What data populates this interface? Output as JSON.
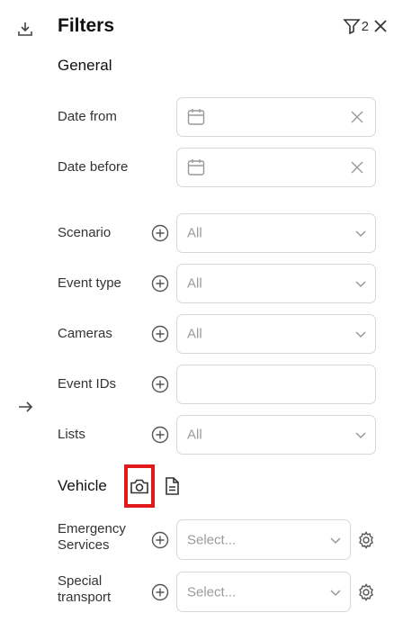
{
  "header": {
    "title": "Filters",
    "active_filter_count": "2"
  },
  "sections": {
    "general": "General",
    "vehicle": "Vehicle"
  },
  "date_fields": [
    {
      "label": "Date from",
      "value": ""
    },
    {
      "label": "Date before",
      "value": ""
    }
  ],
  "select_fields": [
    {
      "label": "Scenario",
      "value": "All"
    },
    {
      "label": "Event type",
      "value": "All"
    },
    {
      "label": "Cameras",
      "value": "All"
    },
    {
      "label": "Event IDs",
      "value": ""
    },
    {
      "label": "Lists",
      "value": "All"
    }
  ],
  "vehicle_fields": [
    {
      "label_line1": "Emergency",
      "label_line2": "Services",
      "placeholder": "Select..."
    },
    {
      "label_line1": "Special",
      "label_line2": "transport",
      "placeholder": "Select..."
    }
  ],
  "icons": {
    "download": "download-icon",
    "expand": "arrow-right-icon",
    "filter": "filter-funnel-icon",
    "close": "close-icon",
    "calendar": "calendar-icon",
    "clear": "clear-icon",
    "add": "plus-circle-icon",
    "chevron": "chevron-down-icon",
    "camera": "camera-icon",
    "document": "document-icon",
    "settings": "gear-icon"
  },
  "colors": {
    "highlight_border": "#e01a1a",
    "border": "#d7d7d7",
    "placeholder_text": "#9a9a9a"
  }
}
